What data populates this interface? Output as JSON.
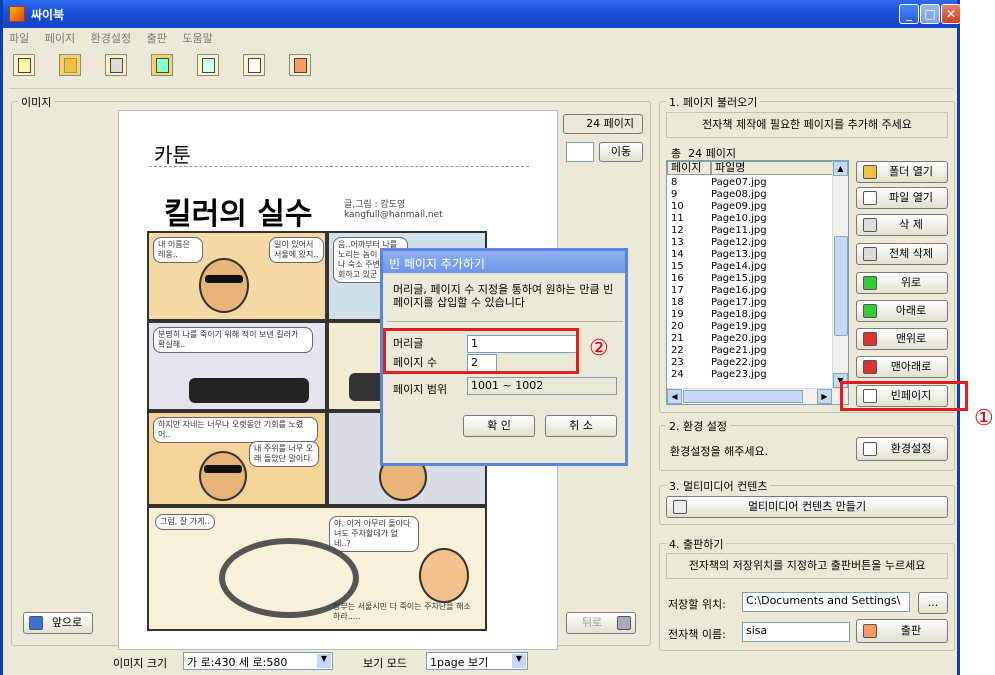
{
  "window": {
    "title": "싸이북"
  },
  "menu": [
    "파일",
    "페이지",
    "환경설정",
    "출판",
    "도움말"
  ],
  "toolbar_icons": [
    "new-page-icon",
    "open-folder-icon",
    "save-icon",
    "import-icon",
    "add-page-icon",
    "settings-icon",
    "export-icon"
  ],
  "image_panel": {
    "legend": "이미지",
    "page_count": "24 페이지",
    "goto_label": "이동",
    "prev_label": "앞으로",
    "next_label": "뒤로",
    "size_label": "이미지 크기",
    "size_value": "가 로:430 세 로:580",
    "view_label": "보기 모드",
    "view_value": "1page 보기"
  },
  "comic": {
    "category": "카툰",
    "headline": "킬러의 실수",
    "credit": "글,그림 : 강도영 kangfull@hanmail.net",
    "b1": "내 이름은 레옹..",
    "b2": "일이 있어서 서울에 왔지..",
    "b3": "음..어까부터 나를 노리는 놈이 계속 나 숙소 주변을 배회하고 있군",
    "b4": "분명히 나를 죽이기 위해 적이 보낸 킬러가 확실해..",
    "b5": "하지만 자네는 너무나 오랫동안 기회를 노렸어..",
    "b6": "내 주위를 너무 오래 돌았단 말이다.",
    "b7": "그럼, 잘 가게..",
    "b8": "야, 이거 아무리 돌아다녀도 주차할데가 없네..?",
    "b9": "정부는 서울시민 다 죽이는 주차난을 해소하라....."
  },
  "section1": {
    "legend": "1. 페이지 불러오기",
    "hint": "전자책 제작에 필요한 페이지를 추가해 주세요",
    "total_prefix": "총",
    "total": "24 페이지",
    "col_page": "페이지",
    "col_file": "파일명",
    "rows": [
      [
        "8",
        "Page07.jpg"
      ],
      [
        "9",
        "Page08.jpg"
      ],
      [
        "10",
        "Page09.jpg"
      ],
      [
        "11",
        "Page10.jpg"
      ],
      [
        "12",
        "Page11.jpg"
      ],
      [
        "13",
        "Page12.jpg"
      ],
      [
        "14",
        "Page13.jpg"
      ],
      [
        "15",
        "Page14.jpg"
      ],
      [
        "16",
        "Page15.jpg"
      ],
      [
        "17",
        "Page16.jpg"
      ],
      [
        "18",
        "Page17.jpg"
      ],
      [
        "19",
        "Page18.jpg"
      ],
      [
        "20",
        "Page19.jpg"
      ],
      [
        "21",
        "Page20.jpg"
      ],
      [
        "22",
        "Page21.jpg"
      ],
      [
        "23",
        "Page22.jpg"
      ],
      [
        "24",
        "Page23.jpg"
      ]
    ],
    "buttons": {
      "open_folder": "폴더 열기",
      "open_file": "파일 열기",
      "delete": "삭 제",
      "delete_all": "전체 삭제",
      "up": "위로",
      "down": "아래로",
      "top": "맨위로",
      "bottom": "맨아래로",
      "blank_page": "빈페이지"
    }
  },
  "section2": {
    "legend": "2. 환경 설정",
    "hint": "환경설정을 해주세요.",
    "button": "환경설정"
  },
  "section3": {
    "legend": "3. 멀티미디어 컨텐츠",
    "button": "멀티미디어 컨텐츠 만들기"
  },
  "section4": {
    "legend": "4. 출판하기",
    "hint": "전자책의 저장위치를 지정하고 출판버튼을 누르세요",
    "path_label": "저장할 위치:",
    "path_value": "C:\\Documents and Settings\\",
    "browse": "...",
    "name_label": "전자책 이름:",
    "name_value": "sisa",
    "publish": "출판"
  },
  "dialog": {
    "title": "빈 페이지 추가하기",
    "message": "머리글, 페이지 수 지정을 통하여 원하는 만큼 빈페이지를 삽입할 수 있습니다",
    "prefix_label": "머리글",
    "prefix_value": "1",
    "count_label": "페이지 수",
    "count_value": "2",
    "range_label": "페이지 범위",
    "range_value": "1001 ~ 1002",
    "ok": "확 인",
    "cancel": "취 소"
  },
  "annotations": {
    "one": "①",
    "two": "②"
  },
  "colors": {
    "titlebar": "#1a52d8",
    "highlight": "#e21f1f"
  }
}
